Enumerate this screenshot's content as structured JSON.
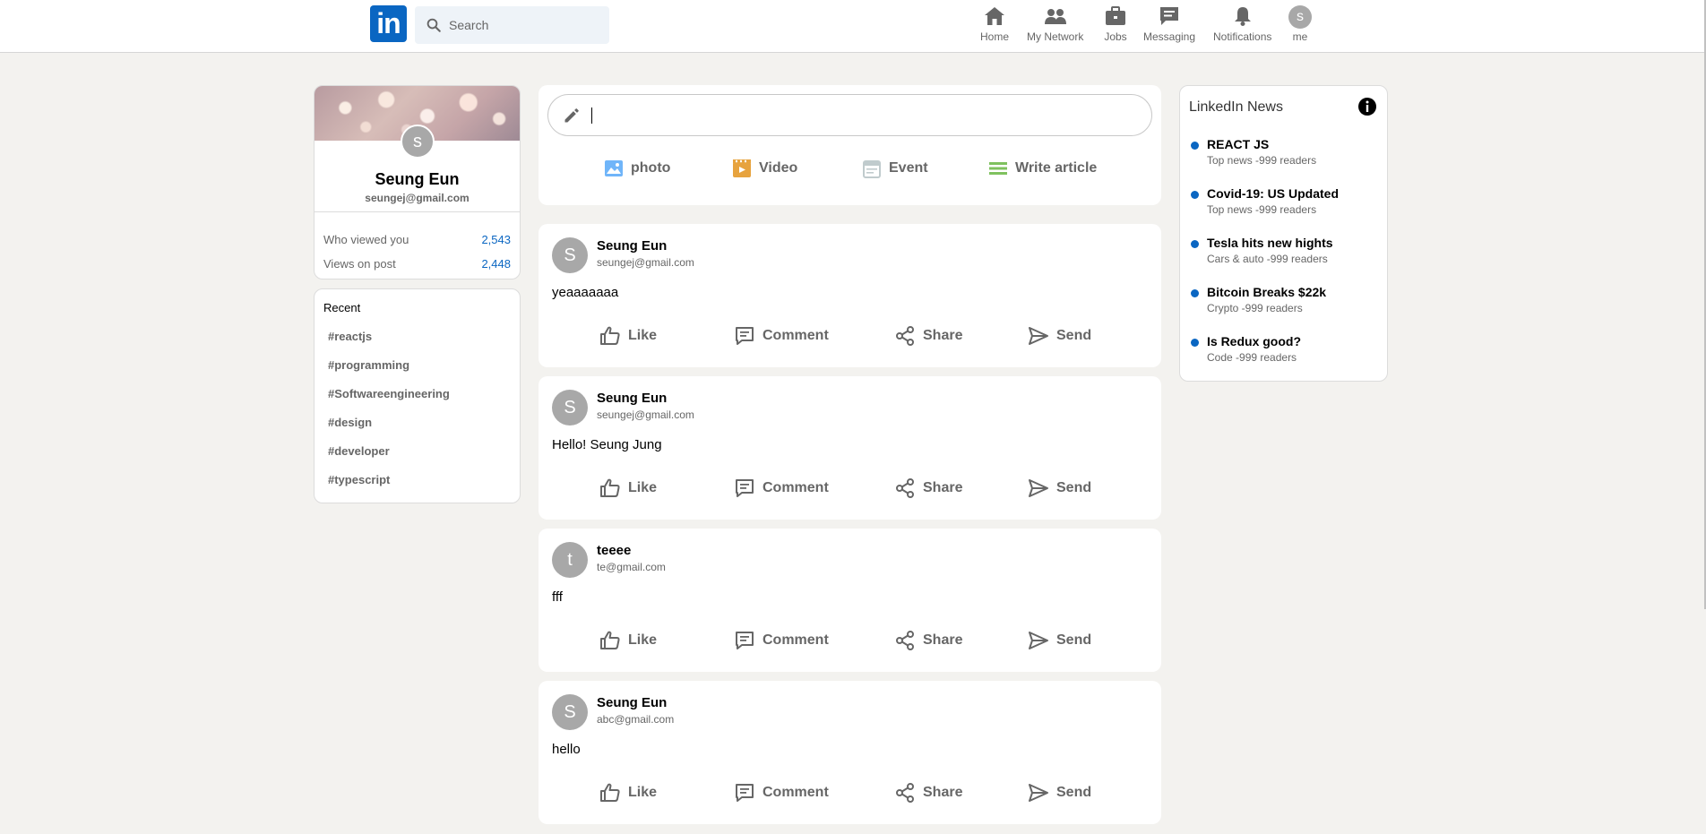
{
  "header": {
    "logo_text": "in",
    "search_placeholder": "Search",
    "nav": [
      {
        "label": "Home",
        "icon": "home-icon"
      },
      {
        "label": "My Network",
        "icon": "network-icon"
      },
      {
        "label": "Jobs",
        "icon": "briefcase-icon"
      },
      {
        "label": "Messaging",
        "icon": "message-icon"
      },
      {
        "label": "Notifications",
        "icon": "bell-icon"
      },
      {
        "label": "me",
        "avatar_letter": "s"
      }
    ]
  },
  "profile": {
    "avatar_letter": "s",
    "name": "Seung Eun",
    "email": "seungej@gmail.com",
    "stats": [
      {
        "label": "Who viewed you",
        "value": "2,543"
      },
      {
        "label": "Views on post",
        "value": "2,448"
      }
    ]
  },
  "recent": {
    "title": "Recent",
    "hashtags": [
      "#reactjs",
      "#programming",
      "#Softwareengineering",
      "#design",
      "#developer",
      "#typescript"
    ]
  },
  "composer": {
    "input_value": "",
    "options": [
      {
        "label": "photo",
        "icon": "photo-icon",
        "color": "#70b5f9"
      },
      {
        "label": "Video",
        "icon": "video-icon",
        "color": "#e7a33e"
      },
      {
        "label": "Event",
        "icon": "calendar-icon",
        "color": "#c0cbcd"
      },
      {
        "label": "Write article",
        "icon": "article-icon",
        "color": "#7fc15e"
      }
    ]
  },
  "posts": [
    {
      "avatar": "S",
      "name": "Seung Eun",
      "email": "seungej@gmail.com",
      "text": "yeaaaaaaa"
    },
    {
      "avatar": "S",
      "name": "Seung Eun",
      "email": "seungej@gmail.com",
      "text": "Hello! Seung Jung"
    },
    {
      "avatar": "t",
      "name": "teeee",
      "email": "te@gmail.com",
      "text": "fff"
    },
    {
      "avatar": "S",
      "name": "Seung Eun",
      "email": "abc@gmail.com",
      "text": "hello"
    }
  ],
  "post_actions": [
    "Like",
    "Comment",
    "Share",
    "Send"
  ],
  "news": {
    "title": "LinkedIn News",
    "items": [
      {
        "headline": "REACT JS",
        "sub": "Top news -999 readers"
      },
      {
        "headline": "Covid-19: US Updated",
        "sub": "Top news -999 readers"
      },
      {
        "headline": "Tesla hits new hights",
        "sub": "Cars & auto -999 readers"
      },
      {
        "headline": "Bitcoin Breaks $22k",
        "sub": "Crypto -999 readers"
      },
      {
        "headline": "Is Redux good?",
        "sub": "Code -999 readers"
      }
    ]
  },
  "colors": {
    "brand": "#0a66c2",
    "background": "#f3f2ef",
    "avatar": "#a8a8a8"
  }
}
